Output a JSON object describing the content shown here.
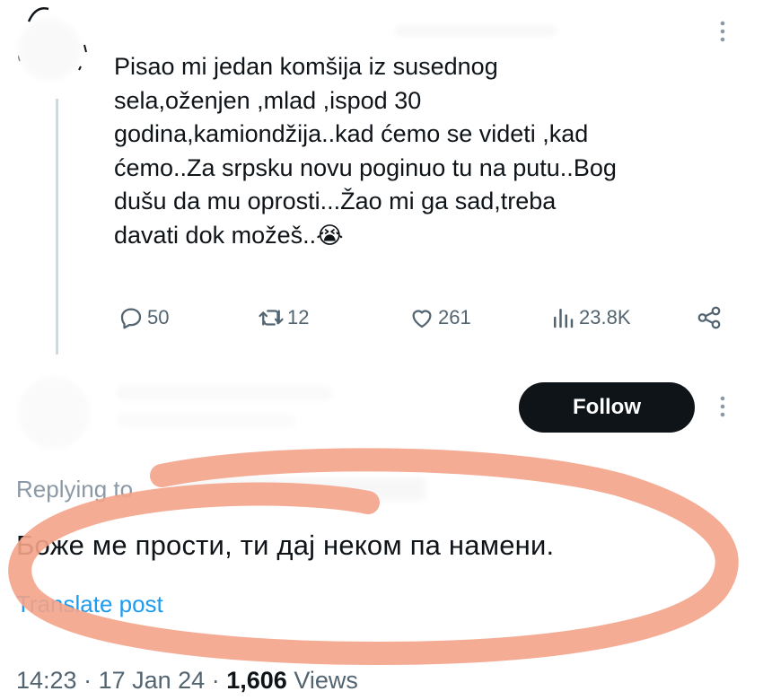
{
  "tweet": {
    "text": "Pisao mi jedan komšija iz susednog\nsela,oženjen ,mlad ,ispod 30\ngodina,kamiondžija..kad ćemo se videti ,kad\nćemo..Za srpsku novu poginuo tu na putu..Bog\ndušu da mu oprosti...Žao mi ga sad,treba\ndavati dok možeš..",
    "emoji": "😭",
    "actions": {
      "replies": "50",
      "retweets": "12",
      "likes": "261",
      "views": "23.8K"
    }
  },
  "reply": {
    "follow_label": "Follow",
    "replying_to": "Replying to",
    "text": "Боже ме прости, ти дај неком па намени.",
    "translate": "Translate post",
    "time": "14:23",
    "date": "17 Jan 24",
    "views_count": "1,606",
    "views_label": "Views"
  },
  "colors": {
    "text": "#0f1419",
    "secondary": "#536471",
    "link": "#1d9bf0",
    "annotation_circle": "#f4a38a"
  },
  "icons": [
    "reply-icon",
    "retweet-icon",
    "like-icon",
    "views-icon",
    "share-icon",
    "more-icon"
  ]
}
